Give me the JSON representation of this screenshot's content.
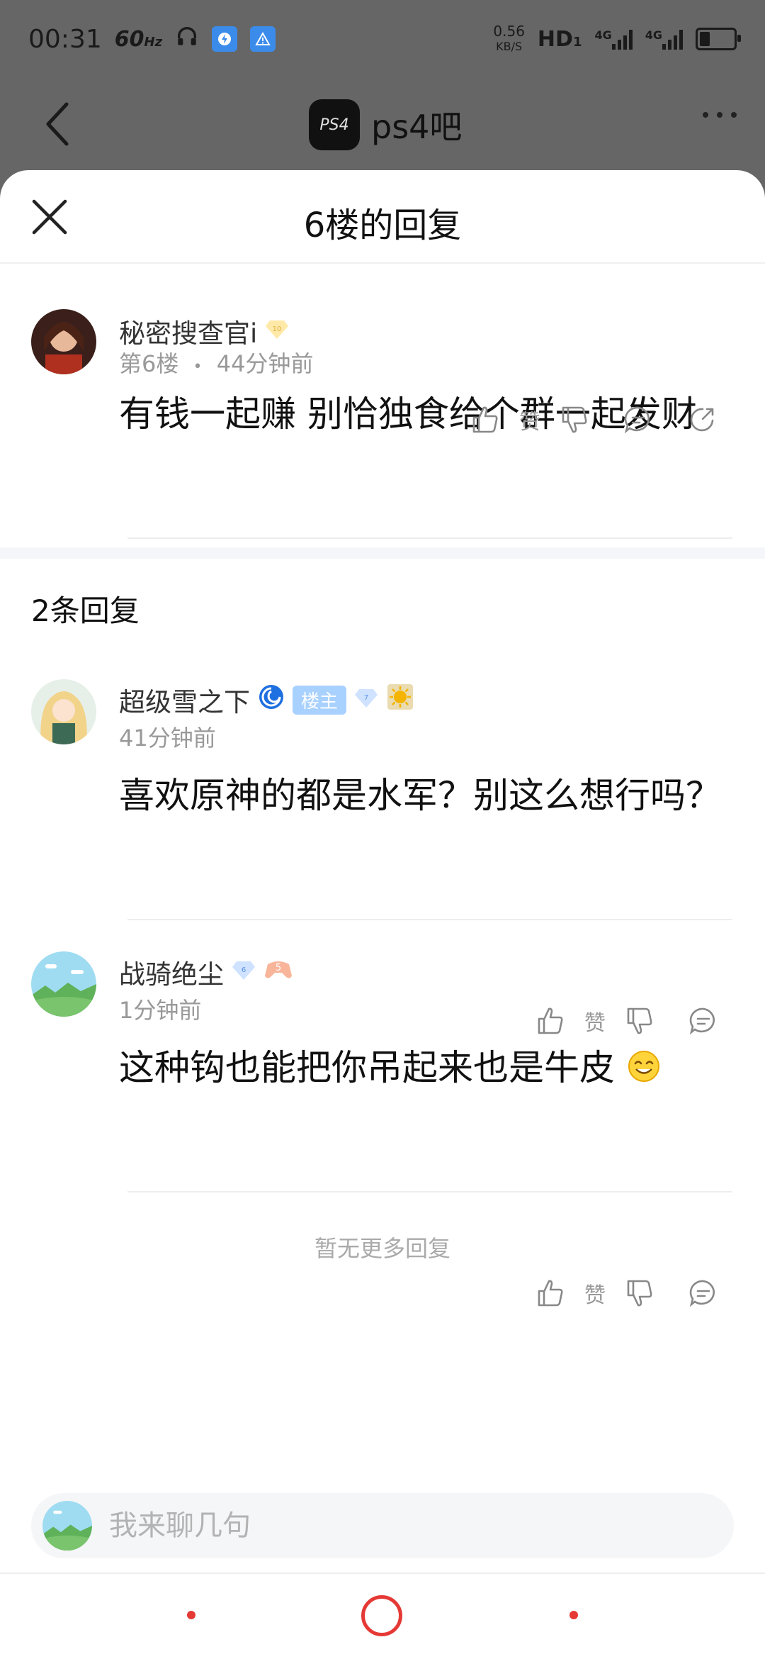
{
  "status_bar": {
    "time": "00:31",
    "refresh_rate": "60",
    "refresh_unit": "Hz",
    "net_speed_value": "0.56",
    "net_speed_unit": "KB/S",
    "hd_label": "HD",
    "hd_sub": "1",
    "net_type_1": "4G",
    "net_type_2": "4G"
  },
  "nav": {
    "forum_name": "ps4吧",
    "forum_logo_text": "PS4"
  },
  "sheet": {
    "title": "6楼的回复"
  },
  "main_post": {
    "username": "秘密搜查官i",
    "level": "10",
    "floor": "第6楼",
    "separator": "•",
    "time": "44分钟前",
    "content": "有钱一起赚 别恰独食给个群一起发财",
    "like_label": "赞"
  },
  "replies_count_label": "2条回复",
  "replies": [
    {
      "username": "超级雪之下",
      "tag": "楼主",
      "level": "7",
      "time": "41分钟前",
      "content": "喜欢原神的都是水军？别这么想行吗？",
      "like_label": "赞"
    },
    {
      "username": "战骑绝尘",
      "level": "6",
      "badge_level": "5",
      "time": "1分钟前",
      "content": "这种钩也能把你吊起来也是牛皮",
      "like_label": "赞"
    }
  ],
  "no_more_label": "暂无更多回复",
  "input": {
    "placeholder": "我来聊几句"
  },
  "colors": {
    "accent_red": "#e53935",
    "tag_blue": "#a8d1ff"
  }
}
